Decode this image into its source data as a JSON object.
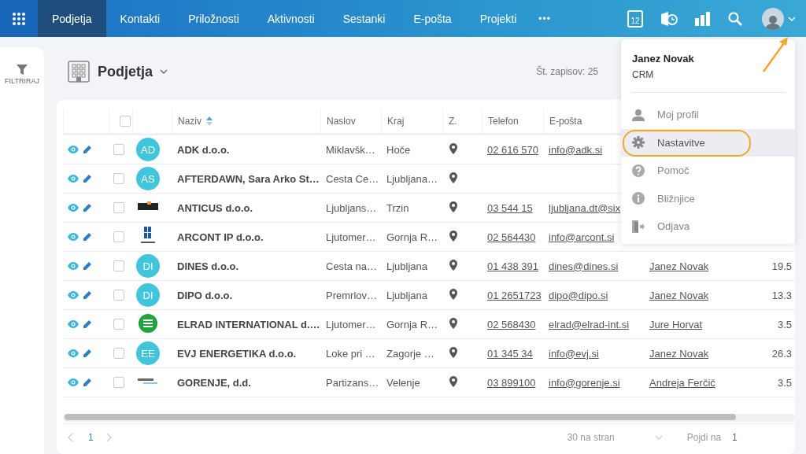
{
  "topbar": {
    "tabs": [
      {
        "label": "Podjetja",
        "selected": true
      },
      {
        "label": "Kontakti",
        "selected": false
      },
      {
        "label": "Priložnosti",
        "selected": false
      },
      {
        "label": "Aktivnosti",
        "selected": false
      },
      {
        "label": "Sestanki",
        "selected": false
      },
      {
        "label": "E-pošta",
        "selected": false
      },
      {
        "label": "Projekti",
        "selected": false
      }
    ],
    "more": "•••",
    "calendar_day": "12"
  },
  "sidebar": {
    "filter_label": "FILTRIRAJ"
  },
  "page": {
    "title": "Podjetja",
    "record_count": "Št. zapisov: 25"
  },
  "table": {
    "header_checked": false,
    "columns": [
      "Naziv",
      "Naslov",
      "Kraj",
      "Z.",
      "Telefon",
      "E-pošta"
    ],
    "rows": [
      {
        "checked": false,
        "avatar": {
          "kind": "initials",
          "text": "AD"
        },
        "name": "ADK d.o.o.",
        "address": "Miklavšk…",
        "city": "Hoče",
        "phone": "02 616 570",
        "email": "info@adk.si"
      },
      {
        "checked": false,
        "avatar": {
          "kind": "initials",
          "text": "AS"
        },
        "name": "AFTERDAWN, Sara Arko St…",
        "address": "Cesta Ce…",
        "city": "Ljubljana…"
      },
      {
        "checked": false,
        "avatar": {
          "kind": "mark"
        },
        "name": "ANTICUS d.o.o.",
        "address": "Ljubljans…",
        "city": "Trzin",
        "phone": "03 544 15",
        "email": "ljubljana.dt@six"
      },
      {
        "checked": false,
        "avatar": {
          "kind": "blocks"
        },
        "name": "ARCONT IP d.o.o.",
        "address": "Ljutomer…",
        "city": "Gornja R…",
        "phone": "02 564430",
        "email": "info@arcont.si"
      },
      {
        "checked": false,
        "avatar": {
          "kind": "initials",
          "text": "DI"
        },
        "name": "DINES d.o.o.",
        "address": "Cesta na…",
        "city": "Ljubljana",
        "phone": "01 438 391",
        "email": "dines@dines.si",
        "column_10": "Janez Novak",
        "column_11": "19.5"
      },
      {
        "checked": false,
        "avatar": {
          "kind": "initials",
          "text": "DI"
        },
        "name": "DIPO d.o.o.",
        "address": "Premrlov…",
        "city": "Ljubljana",
        "phone": "01 2651723",
        "email": "dipo@dipo.si",
        "column_10": "Janez Novak",
        "column_11": "13.3"
      },
      {
        "checked": false,
        "avatar": {
          "kind": "ring"
        },
        "name": "ELRAD INTERNATIONAL d.…",
        "address": "Ljutomer…",
        "city": "Gornja R…",
        "phone": "02 568430",
        "email": "elrad@elrad-int.si",
        "column_10": "Jure Horvat",
        "column_11": "3.5"
      },
      {
        "checked": false,
        "avatar": {
          "kind": "initials",
          "text": "EE"
        },
        "name": "EVJ ENERGETIKA d.o.o.",
        "address": "Loke pri …",
        "city": "Zagorje …",
        "phone": "01 345 34",
        "email": "info@evj.si",
        "column_10": "Janez Novak",
        "column_11": "26.3"
      },
      {
        "checked": false,
        "avatar": {
          "kind": "script"
        },
        "name": "GORENJE, d.d.",
        "address": "Partizans…",
        "city": "Velenje",
        "phone": "03 899100",
        "email": "info@gorenje.si",
        "column_10": "Andreja Ferčič",
        "column_11": "3.5"
      }
    ]
  },
  "pagination": {
    "page": "1",
    "page_size": "30 na stran",
    "goto_label": "Pojdi na",
    "goto_value": "1"
  },
  "user_menu": {
    "name": "Janez Novak",
    "subtitle": "CRM",
    "items": [
      {
        "label": "Moj profil",
        "kind": "profile",
        "selected": false,
        "highlighted": false
      },
      {
        "label": "Nastavitve",
        "kind": "settings",
        "selected": true,
        "highlighted": true
      },
      {
        "label": "Pomoč",
        "kind": "help",
        "selected": false,
        "highlighted": false
      },
      {
        "label": "Bližnjice",
        "kind": "info",
        "selected": false,
        "highlighted": false
      },
      {
        "label": "Odjava",
        "kind": "logout",
        "selected": false,
        "highlighted": false
      }
    ]
  }
}
